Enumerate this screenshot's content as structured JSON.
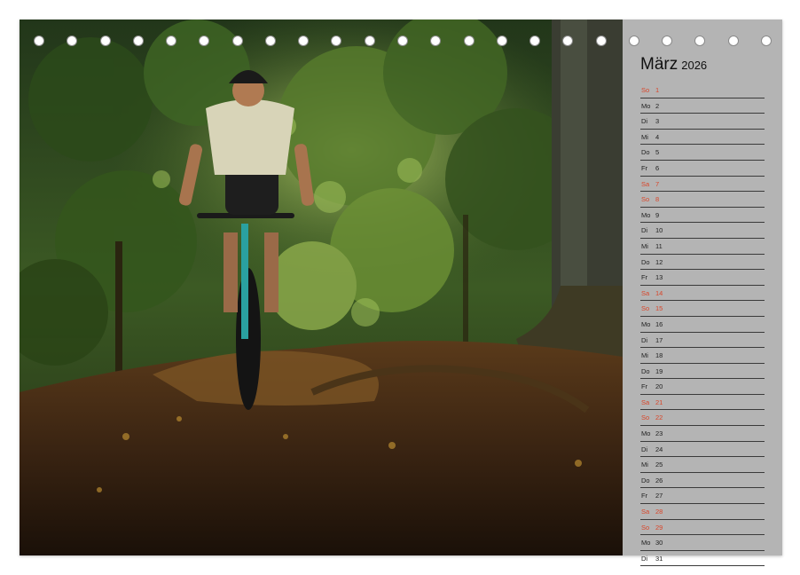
{
  "calendar": {
    "month": "März",
    "year": "2026",
    "days": [
      {
        "dn": "So",
        "dd": "1",
        "weekend": true
      },
      {
        "dn": "Mo",
        "dd": "2",
        "weekend": false
      },
      {
        "dn": "Di",
        "dd": "3",
        "weekend": false
      },
      {
        "dn": "Mi",
        "dd": "4",
        "weekend": false
      },
      {
        "dn": "Do",
        "dd": "5",
        "weekend": false
      },
      {
        "dn": "Fr",
        "dd": "6",
        "weekend": false
      },
      {
        "dn": "Sa",
        "dd": "7",
        "weekend": true
      },
      {
        "dn": "So",
        "dd": "8",
        "weekend": true
      },
      {
        "dn": "Mo",
        "dd": "9",
        "weekend": false
      },
      {
        "dn": "Di",
        "dd": "10",
        "weekend": false
      },
      {
        "dn": "Mi",
        "dd": "11",
        "weekend": false
      },
      {
        "dn": "Do",
        "dd": "12",
        "weekend": false
      },
      {
        "dn": "Fr",
        "dd": "13",
        "weekend": false
      },
      {
        "dn": "Sa",
        "dd": "14",
        "weekend": true
      },
      {
        "dn": "So",
        "dd": "15",
        "weekend": true
      },
      {
        "dn": "Mo",
        "dd": "16",
        "weekend": false
      },
      {
        "dn": "Di",
        "dd": "17",
        "weekend": false
      },
      {
        "dn": "Mi",
        "dd": "18",
        "weekend": false
      },
      {
        "dn": "Do",
        "dd": "19",
        "weekend": false
      },
      {
        "dn": "Fr",
        "dd": "20",
        "weekend": false
      },
      {
        "dn": "Sa",
        "dd": "21",
        "weekend": true
      },
      {
        "dn": "So",
        "dd": "22",
        "weekend": true
      },
      {
        "dn": "Mo",
        "dd": "23",
        "weekend": false
      },
      {
        "dn": "Di",
        "dd": "24",
        "weekend": false
      },
      {
        "dn": "Mi",
        "dd": "25",
        "weekend": false
      },
      {
        "dn": "Do",
        "dd": "26",
        "weekend": false
      },
      {
        "dn": "Fr",
        "dd": "27",
        "weekend": false
      },
      {
        "dn": "Sa",
        "dd": "28",
        "weekend": true
      },
      {
        "dn": "So",
        "dd": "29",
        "weekend": true
      },
      {
        "dn": "Mo",
        "dd": "30",
        "weekend": false
      },
      {
        "dn": "Di",
        "dd": "31",
        "weekend": false
      }
    ]
  },
  "colors": {
    "weekend": "#d9462a",
    "sidebar": "#b4b4b4",
    "rule": "#3a3a3a"
  },
  "binding": {
    "holes": 23
  }
}
